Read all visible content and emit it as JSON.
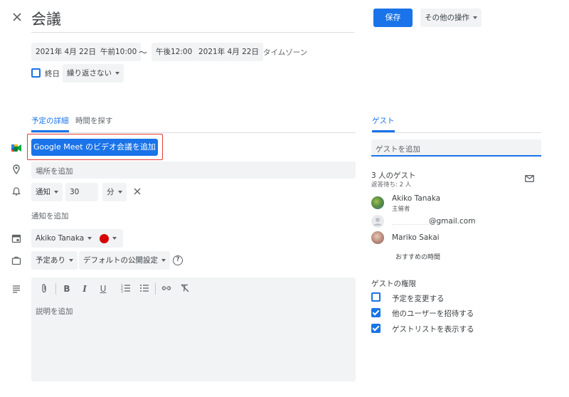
{
  "header": {
    "title": "会議",
    "save": "保存",
    "more_actions": "その他の操作"
  },
  "datetime": {
    "start_date": "2021年 4月 22日",
    "start_time": "午前10:00",
    "separator": "〜",
    "end_time": "午後12:00",
    "end_date": "2021年 4月 22日",
    "timezone": "タイムゾーン",
    "all_day": "終日",
    "repeat": "繰り返さない"
  },
  "tabs": {
    "details": "予定の詳細",
    "find_time": "時間を探す",
    "guests": "ゲスト"
  },
  "meet": {
    "button": "Google Meet のビデオ会議を追加"
  },
  "location": {
    "placeholder": "場所を追加"
  },
  "notification": {
    "type": "通知",
    "value": "30",
    "unit": "分",
    "add": "通知を追加"
  },
  "calendar": {
    "owner": "Akiko Tanaka",
    "color": "#d50000"
  },
  "status": {
    "availability": "予定あり",
    "visibility": "デフォルトの公開設定",
    "help": "?"
  },
  "description": {
    "placeholder": "説明を追加"
  },
  "guests": {
    "input_placeholder": "ゲストを追加",
    "count": "3 人のゲスト",
    "pending": "返答待ち: 2 人",
    "list": [
      {
        "name": "Akiko Tanaka",
        "role": "主催者"
      },
      {
        "name": "@gmail.com",
        "role": ""
      },
      {
        "name": "Mariko Sakai",
        "role": ""
      }
    ],
    "suggested_times": "おすすめの時間"
  },
  "permissions": {
    "title": "ゲストの権限",
    "items": [
      {
        "label": "予定を変更する",
        "checked": false
      },
      {
        "label": "他のユーザーを招待する",
        "checked": true
      },
      {
        "label": "ゲストリストを表示する",
        "checked": true
      }
    ]
  },
  "colors": {
    "accent": "#1a73e8",
    "highlight_border": "#e53935",
    "field_bg": "#f1f3f4"
  }
}
